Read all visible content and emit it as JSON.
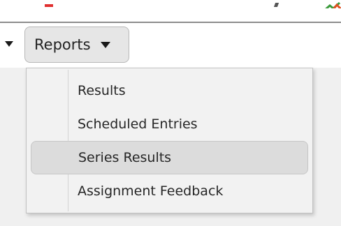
{
  "toolbar": {
    "reports_button_label": "Reports"
  },
  "reports_menu": {
    "items": [
      {
        "label": "Results",
        "highlighted": false
      },
      {
        "label": "Scheduled Entries",
        "highlighted": false
      },
      {
        "label": "Series Results",
        "highlighted": true
      },
      {
        "label": "Assignment Feedback",
        "highlighted": false
      }
    ]
  },
  "colors": {
    "menu_background": "#f2f2f2",
    "menu_highlight": "#dcdcdc",
    "button_background": "#e6e6e6",
    "text": "#262626"
  },
  "icons": {
    "previous_menu_caret": "caret-down-icon",
    "reports_caret": "caret-down-icon",
    "top_right_partial_icon": "chart-icon"
  }
}
